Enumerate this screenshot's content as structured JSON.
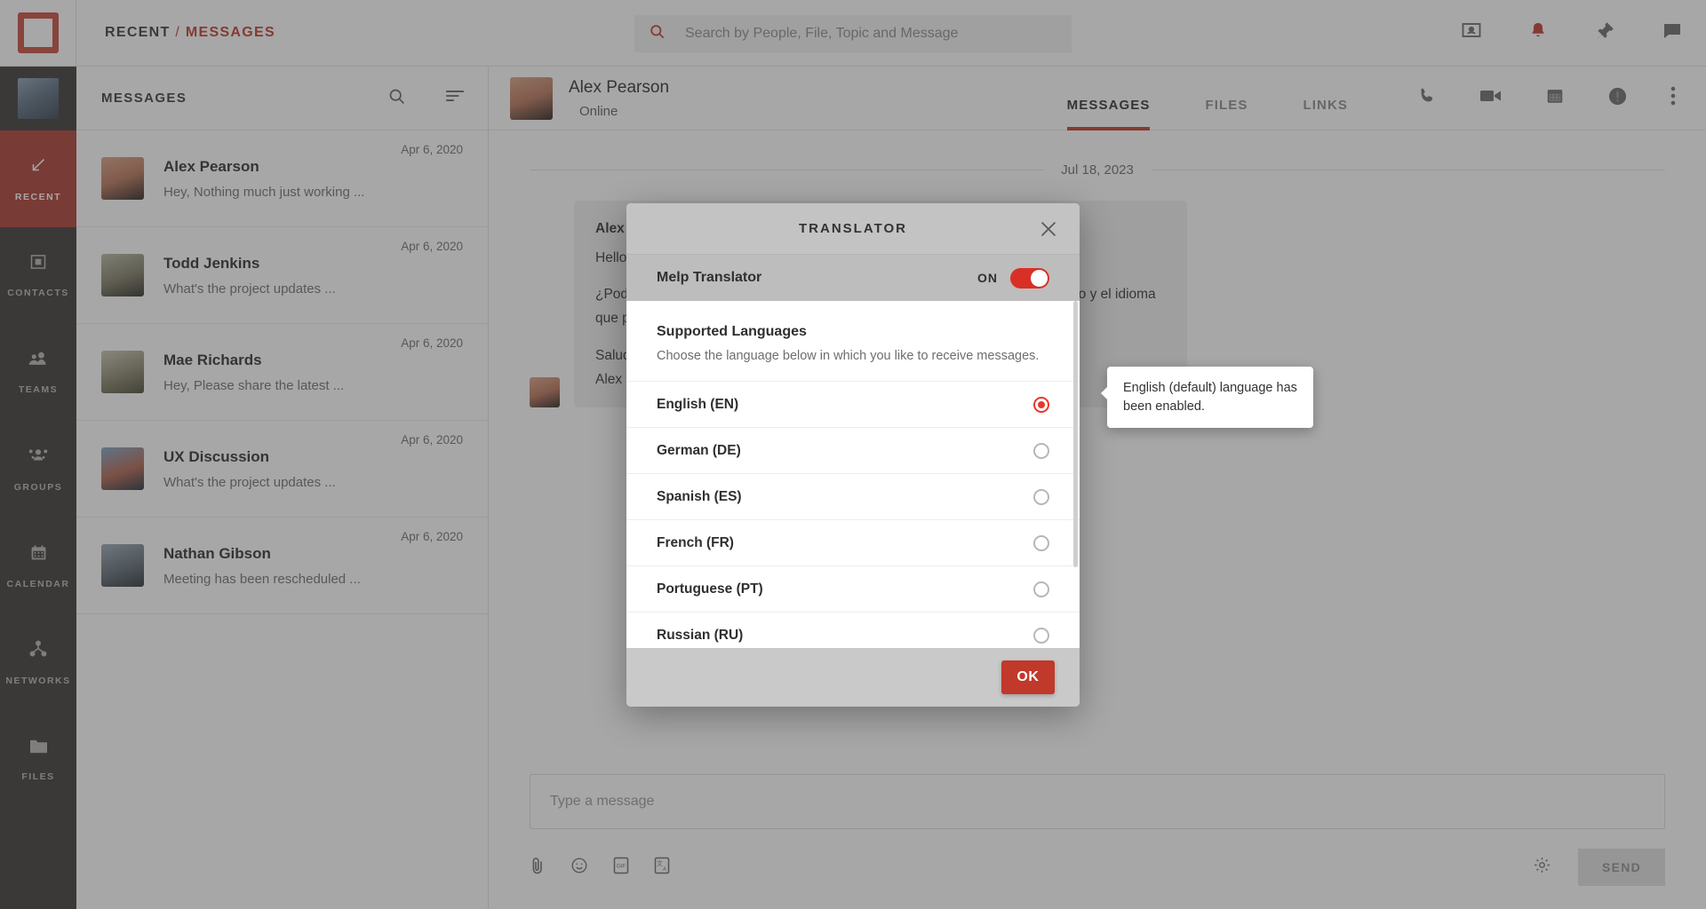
{
  "topbar": {
    "breadcrumb": {
      "root": "RECENT",
      "separator": "/",
      "current": "MESSAGES"
    },
    "search": {
      "placeholder": "Search by People, File, Topic and Message",
      "value": ""
    },
    "actions": [
      {
        "name": "presentation-icon",
        "label": "Presentation"
      },
      {
        "name": "bell-icon",
        "label": "Notifications"
      },
      {
        "name": "pin-icon",
        "label": "Pinned"
      },
      {
        "name": "chat-icon",
        "label": "Chat"
      }
    ]
  },
  "rail": {
    "items": [
      {
        "label": "RECENT",
        "icon": "arrow-down-left-icon",
        "active": true
      },
      {
        "label": "CONTACTS",
        "icon": "contact-card-icon",
        "active": false
      },
      {
        "label": "TEAMS",
        "icon": "teams-icon",
        "active": false
      },
      {
        "label": "GROUPS",
        "icon": "groups-icon",
        "active": false
      },
      {
        "label": "CALENDAR",
        "icon": "calendar-icon",
        "active": false
      },
      {
        "label": "NETWORKS",
        "icon": "network-icon",
        "active": false
      },
      {
        "label": "FILES",
        "icon": "folder-icon",
        "active": false
      }
    ]
  },
  "list": {
    "title": "MESSAGES",
    "search_icon": "search-icon",
    "filter_icon": "sort-icon",
    "conversations": [
      {
        "name": "Alex Pearson",
        "preview": "Hey, Nothing much just working ...",
        "date": "Apr 6, 2020"
      },
      {
        "name": "Todd Jenkins",
        "preview": "What's the project updates ...",
        "date": "Apr 6, 2020"
      },
      {
        "name": "Mae Richards",
        "preview": "Hey, Please share the latest ...",
        "date": "Apr 6, 2020"
      },
      {
        "name": "UX Discussion",
        "preview": "What's the project updates ...",
        "date": "Apr 6, 2020"
      },
      {
        "name": "Nathan Gibson",
        "preview": "Meeting has been rescheduled ...",
        "date": "Apr 6, 2020"
      }
    ]
  },
  "chat": {
    "contact_name": "Alex Pearson",
    "contact_status": "Online",
    "tabs": [
      {
        "label": "MESSAGES",
        "selected": true
      },
      {
        "label": "FILES",
        "selected": false
      },
      {
        "label": "LINKS",
        "selected": false
      }
    ],
    "head_icons": [
      {
        "name": "phone-icon"
      },
      {
        "name": "video-icon"
      },
      {
        "name": "calendar-icon"
      },
      {
        "name": "info-icon"
      },
      {
        "name": "more-vertical-icon"
      }
    ],
    "date_separator": "Jul 18, 2023",
    "message": {
      "sender": "Alex Pearson",
      "line1": "Hello",
      "line2": "¿Podrías compartir conmigo los detalles del proyecto en el que estás trabajando y el idioma que prefieres?",
      "line3": "Saludos,",
      "line4": "Alex"
    },
    "composer": {
      "placeholder": "Type a message",
      "value": "",
      "tools": [
        {
          "name": "attachment-icon"
        },
        {
          "name": "emoji-icon"
        },
        {
          "name": "gif-icon"
        },
        {
          "name": "translate-icon"
        }
      ],
      "settings_icon": "gear-icon",
      "send_label": "SEND"
    }
  },
  "modal": {
    "title": "TRANSLATOR",
    "close_icon": "close-icon",
    "toggle": {
      "label": "Melp Translator",
      "state_label": "ON",
      "enabled": true
    },
    "languages_heading": "Supported Languages",
    "languages_subtext": "Choose the language below in which you like to receive messages.",
    "languages": [
      {
        "label": "English (EN)",
        "selected": true
      },
      {
        "label": "German (DE)",
        "selected": false
      },
      {
        "label": "Spanish (ES)",
        "selected": false
      },
      {
        "label": "French (FR)",
        "selected": false
      },
      {
        "label": "Portuguese (PT)",
        "selected": false
      },
      {
        "label": "Russian (RU)",
        "selected": false
      }
    ],
    "ok_label": "OK"
  },
  "tooltip": {
    "text": "English (default) language has been enabled."
  },
  "colors": {
    "accent_red": "#c0392b",
    "toggle_red": "#d93025",
    "radio_red": "#e8372b",
    "rail_bg": "#3b3836",
    "rail_active": "#ab3b30"
  }
}
